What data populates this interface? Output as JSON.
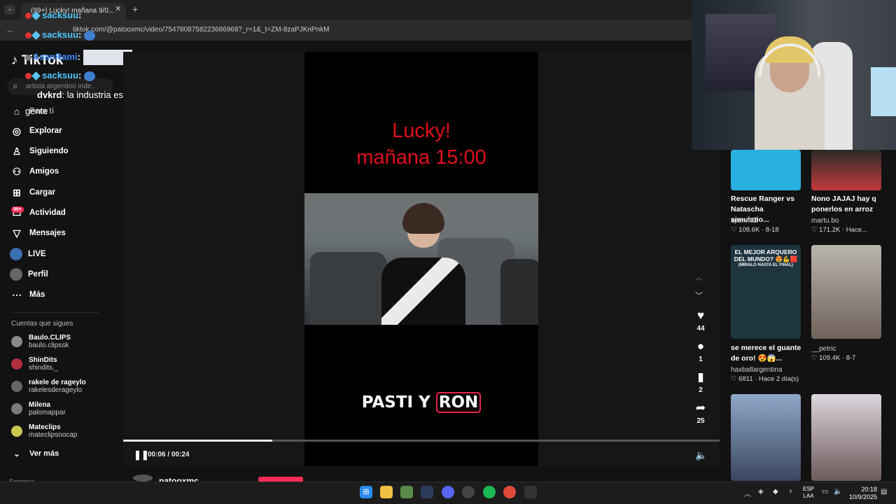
{
  "browser": {
    "tab_title": "(99+) Lucky! mañana 9/0...",
    "url": "tiktok.com/@patooxmc/video/7547808758223686968?_r=1&_t=ZM-8zaPJKnPnkM"
  },
  "chat": [
    {
      "user": "sacksuu",
      "text": ""
    },
    {
      "user": "sacksuu",
      "text": ""
    },
    {
      "user": "AsanRami",
      "text": ""
    },
    {
      "user": "sacksuu",
      "text": ""
    },
    {
      "user": "dvkrd",
      "text": "la industria esta saturada por esta"
    },
    {
      "user": "",
      "text": "gente"
    }
  ],
  "sidebar": {
    "logo": "TikTok",
    "search_placeholder": "artista argentino inde...",
    "items": [
      {
        "label": "Para ti",
        "icon": "home-icon"
      },
      {
        "label": "Explorar",
        "icon": "compass-icon"
      },
      {
        "label": "Siguiendo",
        "icon": "following-icon"
      },
      {
        "label": "Amigos",
        "icon": "friends-icon"
      },
      {
        "label": "Cargar",
        "icon": "upload-icon"
      },
      {
        "label": "Actividad",
        "icon": "activity-icon",
        "badge": "99+"
      },
      {
        "label": "Mensajes",
        "icon": "messages-icon"
      },
      {
        "label": "LIVE",
        "icon": "live-icon"
      },
      {
        "label": "Perfil",
        "icon": "profile-icon"
      },
      {
        "label": "Más",
        "icon": "more-icon"
      }
    ],
    "following_heading": "Cuentas que sigues",
    "following": [
      {
        "name": "Baulo.CLIPS",
        "handle": "baulo.clipssk",
        "color": "#8a8a8a"
      },
      {
        "name": "ShinDits",
        "handle": "shindits._",
        "color": "#b03040"
      },
      {
        "name": "rakele de rageylo",
        "handle": "rakelesderageylo",
        "color": "#666666"
      },
      {
        "name": "Milena",
        "handle": "palomappar",
        "color": "#7a7a7a"
      },
      {
        "name": "Mateclips",
        "handle": "mateclipsnocap",
        "color": "#c8c850"
      }
    ],
    "see_more": "Ver más",
    "footer": "Empresa"
  },
  "video": {
    "caption_top_1": "Lucky!",
    "caption_top_2": "mañana 15:00",
    "caption_bottom_1": "PASTI Y",
    "caption_bottom_2": "RON",
    "progress": 0.25,
    "time": "00:06 / 00:24",
    "author": "patooxmc"
  },
  "actions": {
    "likes": "44",
    "comments": "1",
    "saves": "2",
    "shares": "25"
  },
  "recommended": [
    {
      "title": "Rescue Ranger vs Natascha simulatio...",
      "author": "spenntf2",
      "meta": "108.6K · 8-18"
    },
    {
      "title": "Nono JAJAJ hay q ponerlos en arroz",
      "author": "martu.bo",
      "meta": "171.2K · Hace..."
    },
    {
      "title": "se merece el guante de oro! 😍😱...",
      "author": "haxballargentina",
      "meta": "6811 · Hace 2 día(s)",
      "thumb_text": "EL MEJOR ARQUERO DEL MUNDO? 😍💪🟥",
      "thumb_sub": "(MIRALO HASTA EL FINAL)"
    },
    {
      "title": "",
      "author": "__petric",
      "meta": "109.4K · 8-7"
    }
  ],
  "taskbar": {
    "lang_1": "ESP",
    "lang_2": "LAA",
    "time": "20:18",
    "date": "10/9/2025"
  }
}
